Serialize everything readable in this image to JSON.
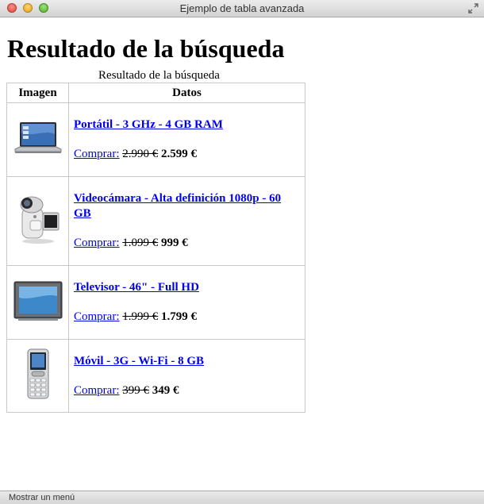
{
  "window": {
    "title": "Ejemplo de tabla avanzada"
  },
  "page": {
    "heading": "Resultado de la búsqueda"
  },
  "table": {
    "caption": "Resultado de la búsqueda",
    "headers": {
      "image": "Imagen",
      "data": "Datos"
    },
    "rows": [
      {
        "icon": "laptop-icon",
        "name": "Portátil - 3 GHz - 4 GB RAM",
        "buy": "Comprar:",
        "old_price": "2.990 €",
        "new_price": "2.599 €"
      },
      {
        "icon": "camcorder-icon",
        "name": "Videocámara - Alta definición 1080p - 60 GB",
        "buy": "Comprar:",
        "old_price": "1.099 €",
        "new_price": "999 €"
      },
      {
        "icon": "television-icon",
        "name": "Televisor - 46\" - Full HD",
        "buy": "Comprar:",
        "old_price": "1.999 €",
        "new_price": "1.799 €"
      },
      {
        "icon": "mobile-phone-icon",
        "name": "Móvil - 3G - Wi-Fi - 8 GB",
        "buy": "Comprar:",
        "old_price": "399 €",
        "new_price": "349 €"
      }
    ]
  },
  "statusbar": {
    "text": "Mostrar un menú"
  }
}
